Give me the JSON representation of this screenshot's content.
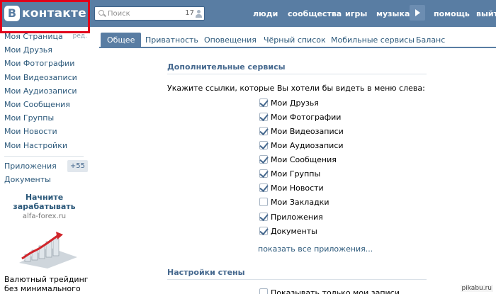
{
  "header": {
    "logo_letter": "В",
    "logo_text": "контакте",
    "search": {
      "placeholder": "Поиск",
      "count": "17"
    },
    "nav": {
      "people": "люди",
      "communities": "сообщества",
      "games": "игры",
      "music": "музыка",
      "help": "помощь",
      "exit": "выйти"
    }
  },
  "sidebar": {
    "items": [
      {
        "label": "Моя Страница",
        "edit": "ред."
      },
      {
        "label": "Мои Друзья"
      },
      {
        "label": "Мои Фотографии"
      },
      {
        "label": "Мои Видеозаписи"
      },
      {
        "label": "Мои Аудиозаписи"
      },
      {
        "label": "Мои Сообщения"
      },
      {
        "label": "Мои Группы"
      },
      {
        "label": "Мои Новости"
      },
      {
        "label": "Мои Настройки"
      }
    ],
    "apps": {
      "label": "Приложения",
      "badge": "+55"
    },
    "documents": "Документы"
  },
  "ad": {
    "title_line1": "Начните",
    "title_line2": "зарабатывать",
    "domain": "alfa-forex.ru",
    "body_line1": "Валютный трейдинг",
    "body_line2": "без минимального"
  },
  "tabs": [
    {
      "label": "Общее",
      "active": true
    },
    {
      "label": "Приватность"
    },
    {
      "label": "Оповещения"
    },
    {
      "label": "Чёрный список"
    },
    {
      "label": "Мобильные сервисы"
    },
    {
      "label": "Баланс"
    }
  ],
  "content": {
    "section1_title": "Дополнительные сервисы",
    "hint": "Укажите ссылки, которые Вы хотели бы видеть в меню слева:",
    "options": [
      {
        "label": "Мои Друзья",
        "checked": true
      },
      {
        "label": "Мои Фотографии",
        "checked": true
      },
      {
        "label": "Мои Видеозаписи",
        "checked": true
      },
      {
        "label": "Мои Аудиозаписи",
        "checked": true
      },
      {
        "label": "Мои Сообщения",
        "checked": true
      },
      {
        "label": "Мои Группы",
        "checked": true
      },
      {
        "label": "Мои Новости",
        "checked": true
      },
      {
        "label": "Мои Закладки",
        "checked": false
      },
      {
        "label": "Приложения",
        "checked": true
      },
      {
        "label": "Документы",
        "checked": true
      }
    ],
    "show_all": "показать все приложения...",
    "section2_title": "Настройки стены",
    "partial_option": "Показывать только мои записи"
  },
  "watermark": "pikabu.ru",
  "colors": {
    "header_bg": "#597da3",
    "link": "#2b587a",
    "highlight": "#e0001b"
  }
}
